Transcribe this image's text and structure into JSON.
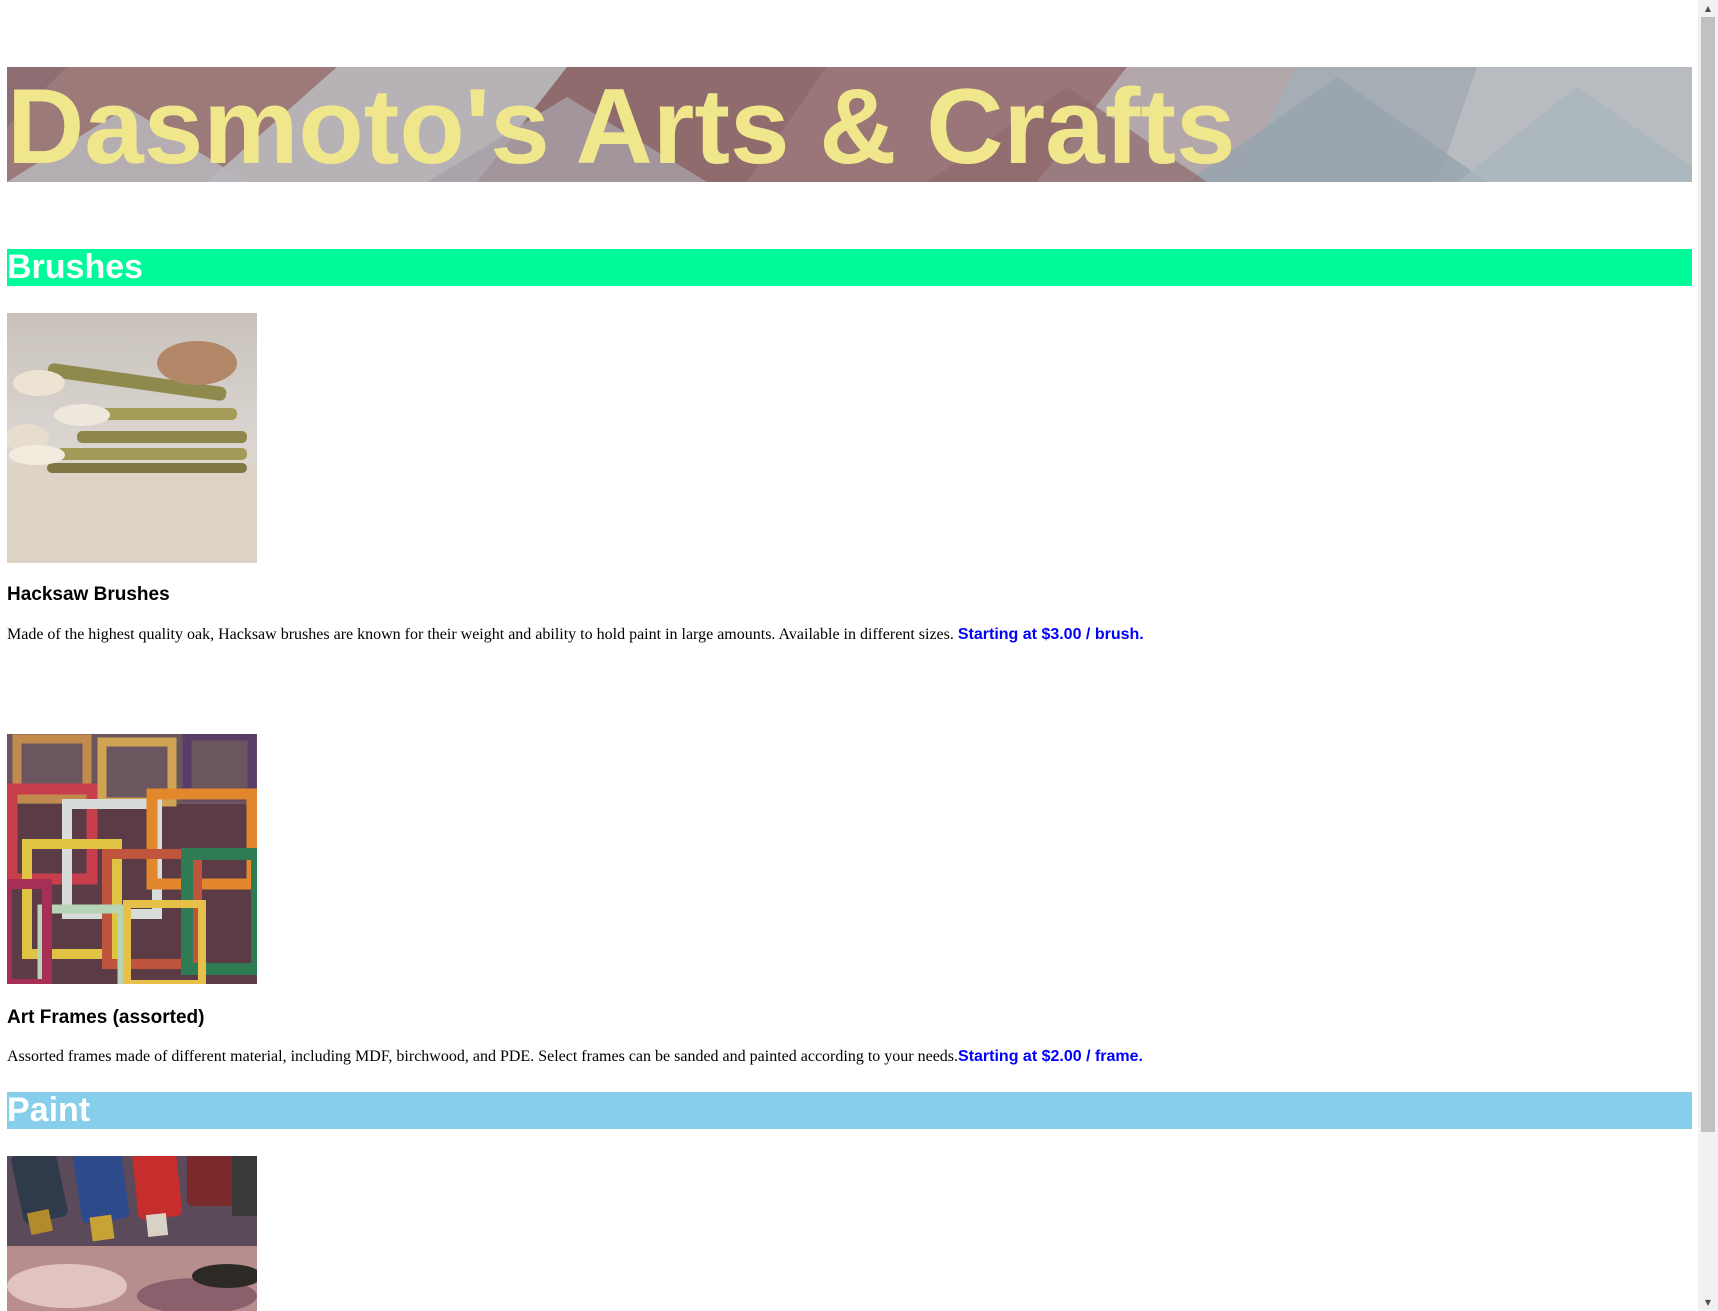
{
  "site": {
    "title": "Dasmoto's Arts & Crafts"
  },
  "sections": {
    "brushes": {
      "heading": "Brushes",
      "color": "#00fa9a",
      "products": [
        {
          "name": "Hacksaw Brushes",
          "description": "Made of the highest quality oak, Hacksaw brushes are known for their weight and ability to hold paint in large amounts. Available in different sizes. ",
          "price": "Starting at $3.00 / brush."
        },
        {
          "name": "Art Frames (assorted)",
          "description": "Assorted frames made of different material, including MDF, birchwood, and PDE. Select frames can be sanded and painted according to your needs.",
          "price": "Starting at $2.00 / frame."
        }
      ]
    },
    "paint": {
      "heading": "Paint",
      "color": "#87ceeb"
    }
  },
  "colors": {
    "title": "#f0e68c",
    "price": "#0000ff"
  },
  "icons": {
    "scroll_up": "arrow-up-icon",
    "scroll_down": "arrow-down-icon"
  }
}
